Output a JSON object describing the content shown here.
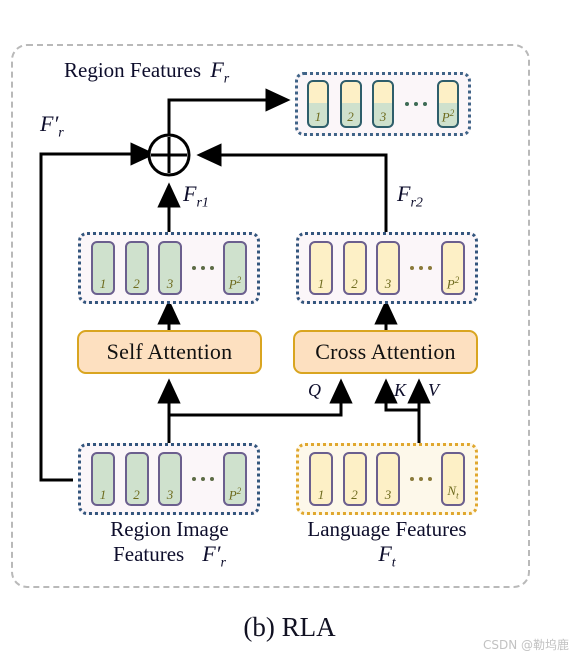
{
  "figure": {
    "caption": "(b) RLA",
    "watermark": "CSDN @勒坞鹿",
    "accent_colors": {
      "dashed_frame": "#b9b9b9",
      "attention_fill": "#fde0c0",
      "attention_border": "#d9a520",
      "cell_green": "#cfe1cd",
      "cell_yellow": "#fdf0c6",
      "cell_border": "#6b5f8e",
      "group_border_blue": "#33557d",
      "group_border_gold": "#e0a72e",
      "group_fill_pink": "#fbf6f9",
      "group_fill_cream": "#fdf8ea",
      "cell_label_text": "#6e6b1e",
      "line": "#000000"
    }
  },
  "labels": {
    "region_features": "Region Features",
    "region_features_symbol": "F",
    "region_features_sub": "r",
    "f_r_prime": "F",
    "f_r_prime_sub": "r",
    "f_r1": "F",
    "f_r1_sub": "r1",
    "f_r2": "F",
    "f_r2_sub": "r2",
    "region_image_features_line1": "Region Image",
    "region_image_features_line2": "Features",
    "region_image_symbol": "F",
    "region_image_sub": "r",
    "language_features": "Language Features",
    "language_symbol": "F",
    "language_sub": "t",
    "q": "Q",
    "k": "K",
    "v": "V",
    "plus": "+"
  },
  "blocks": {
    "self_attention": "Self Attention",
    "cross_attention": "Cross Attention"
  },
  "token_groups": [
    {
      "id": "region-features",
      "name": "Region Features",
      "style": "split",
      "border": "blue-dotted",
      "cells": [
        "1",
        "2",
        "3",
        "P²"
      ],
      "ellipsis_after_index": 3
    },
    {
      "id": "f-r1",
      "name": "F r1",
      "style": "green",
      "border": "blue-dotted",
      "cells": [
        "1",
        "2",
        "3",
        "P²"
      ],
      "ellipsis_after_index": 3
    },
    {
      "id": "f-r2",
      "name": "F r2",
      "style": "yellow",
      "border": "blue-dotted",
      "cells": [
        "1",
        "2",
        "3",
        "P²"
      ],
      "ellipsis_after_index": 3
    },
    {
      "id": "region-image-features",
      "name": "Region Image Features",
      "style": "green",
      "border": "blue-dotted",
      "cells": [
        "1",
        "2",
        "3",
        "P²"
      ],
      "ellipsis_after_index": 3
    },
    {
      "id": "language-features",
      "name": "Language Features",
      "style": "yellow",
      "border": "gold-dotted",
      "cells": [
        "1",
        "2",
        "3",
        "Nₜ"
      ],
      "ellipsis_after_index": 3
    }
  ],
  "cells": {
    "one": "1",
    "two": "2",
    "three": "3",
    "p_squared": "P",
    "p_exp": "2",
    "n_t": "N",
    "n_sub": "t"
  }
}
